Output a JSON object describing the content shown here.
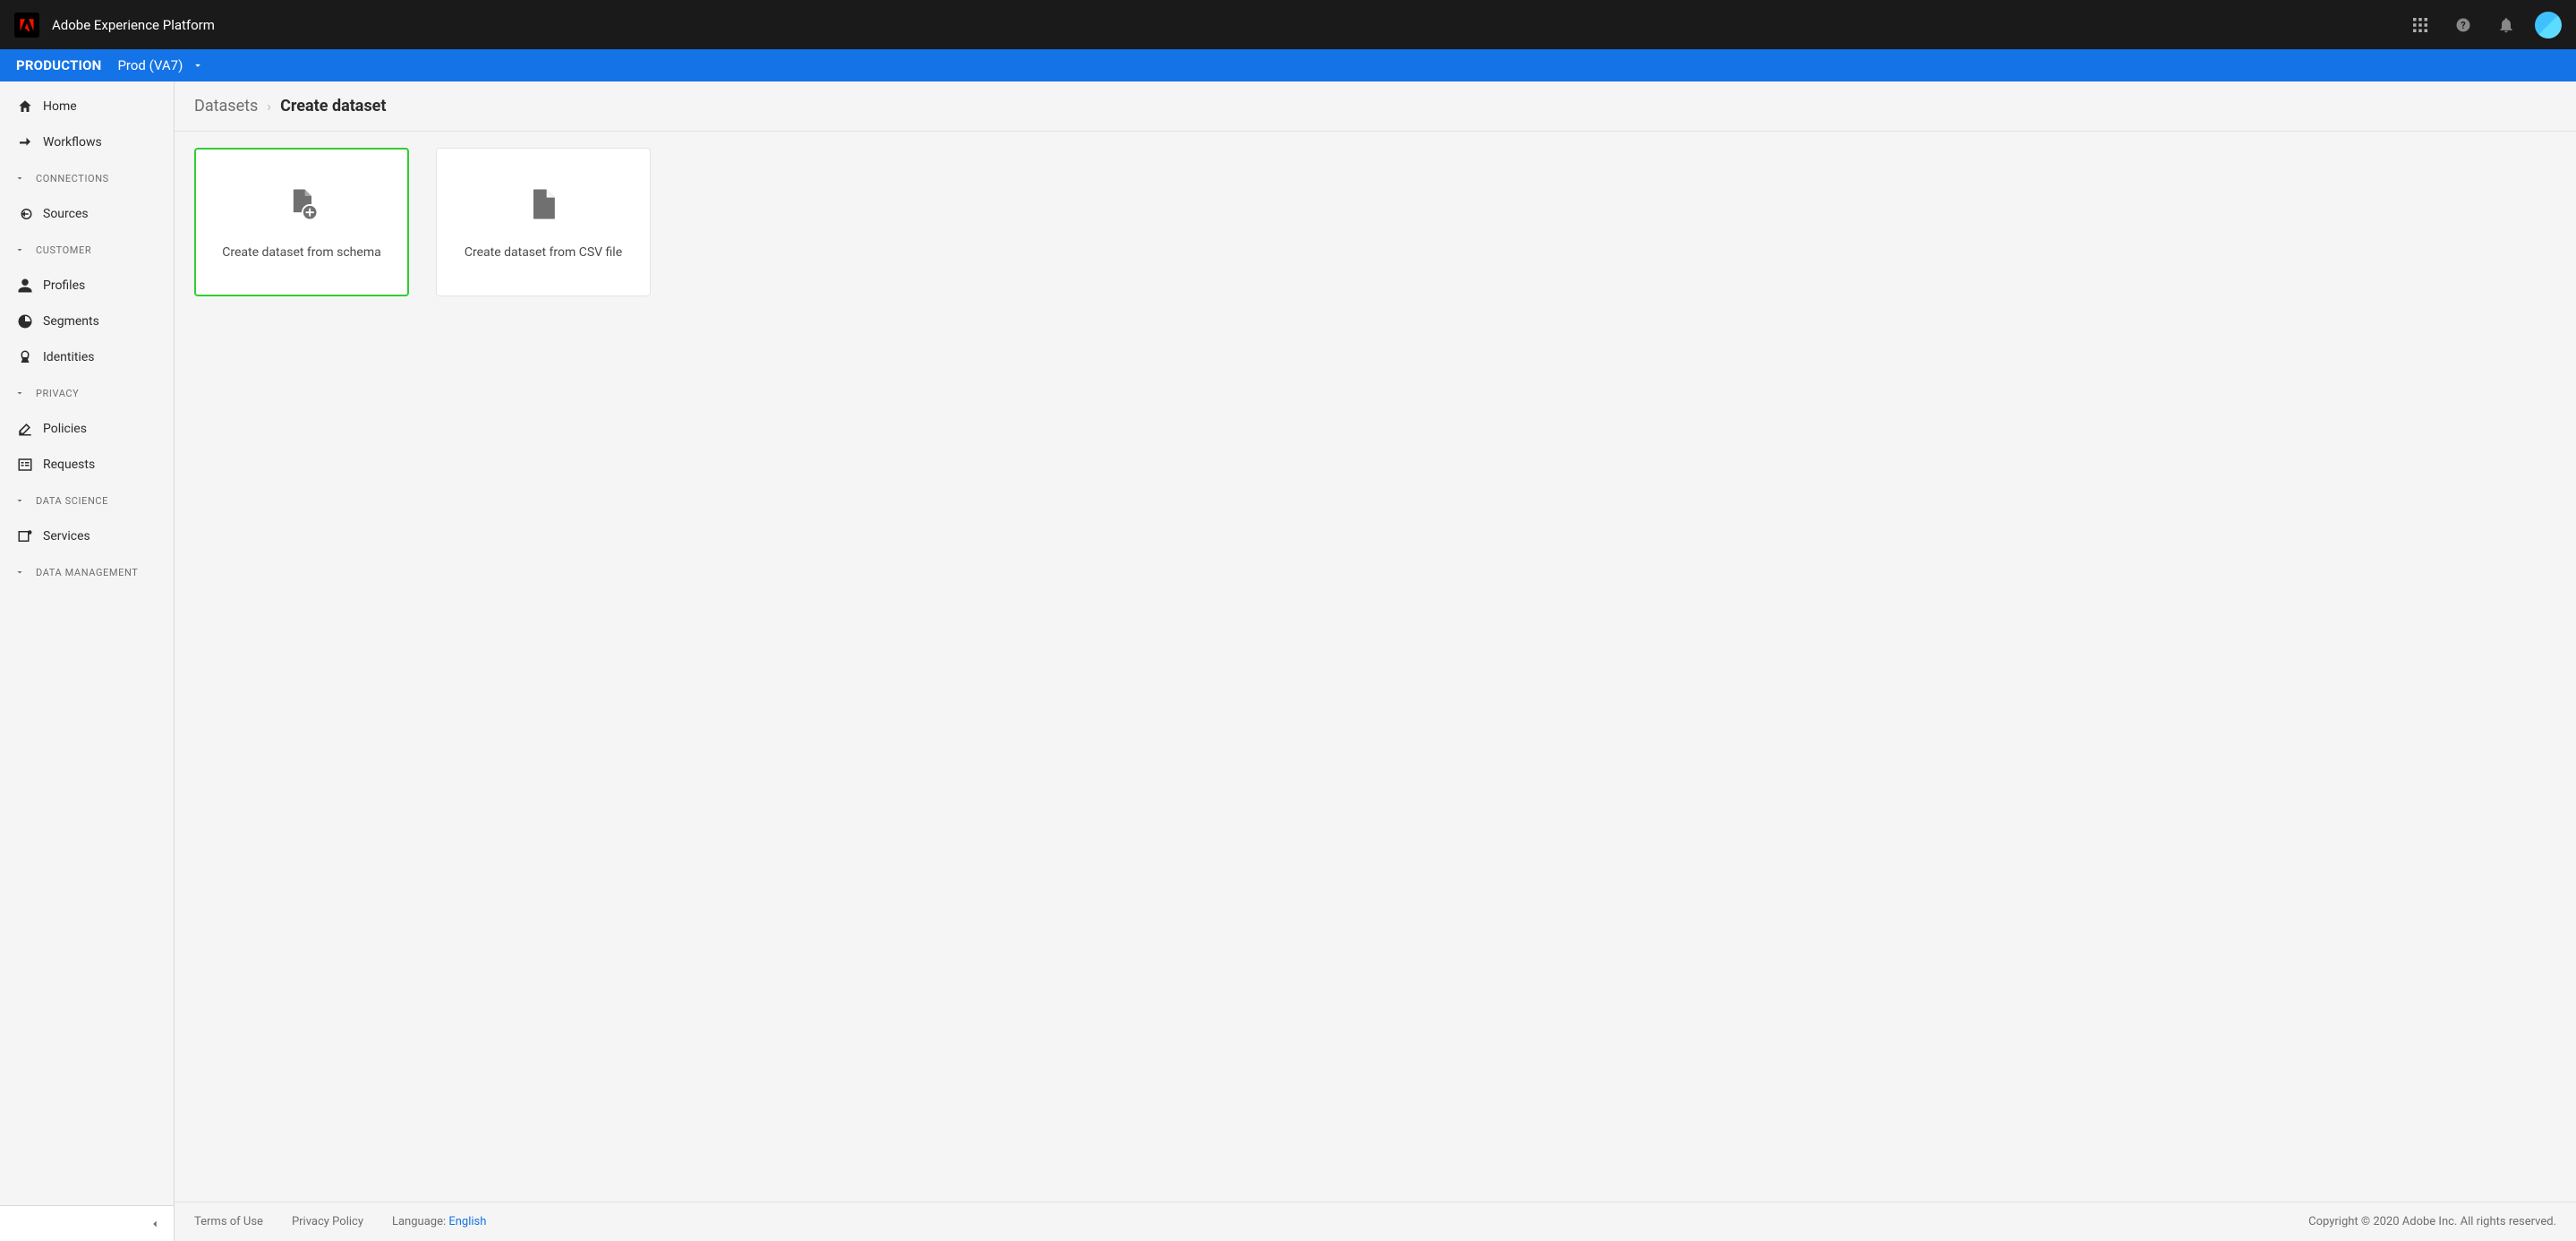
{
  "header": {
    "app_title": "Adobe Experience Platform"
  },
  "sub_header": {
    "env_label": "PRODUCTION",
    "env_value": "Prod (VA7)"
  },
  "sidebar": {
    "home": "Home",
    "workflows": "Workflows",
    "sections": {
      "connections": "CONNECTIONS",
      "customer": "CUSTOMER",
      "privacy": "PRIVACY",
      "data_science": "DATA SCIENCE",
      "data_management": "DATA MANAGEMENT"
    },
    "items": {
      "sources": "Sources",
      "profiles": "Profiles",
      "segments": "Segments",
      "identities": "Identities",
      "policies": "Policies",
      "requests": "Requests",
      "services": "Services"
    }
  },
  "breadcrumb": {
    "parent": "Datasets",
    "current": "Create dataset"
  },
  "cards": {
    "from_schema": "Create dataset from schema",
    "from_csv": "Create dataset from CSV file"
  },
  "footer": {
    "terms": "Terms of Use",
    "privacy": "Privacy Policy",
    "language_label": "Language: ",
    "language_value": "English",
    "copyright": "Copyright  ©  2020 Adobe Inc.  All rights reserved."
  }
}
